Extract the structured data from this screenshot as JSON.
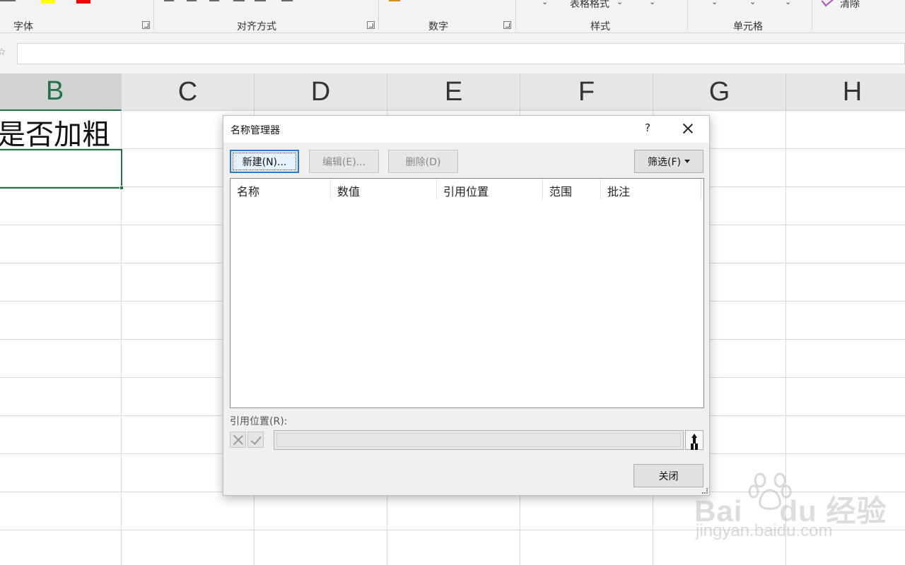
{
  "ribbon": {
    "groups": [
      {
        "label": "字体"
      },
      {
        "label": "对齐方式"
      },
      {
        "label": "数字"
      },
      {
        "label": "样式"
      },
      {
        "label": "单元格"
      }
    ],
    "table_format_label": "表格格式",
    "clear_label": "清除",
    "colors": {
      "highlight": "#ffff00",
      "font_color": "#ff0000"
    }
  },
  "formula_bar": {
    "fx_icon": "fx-icon",
    "value": ""
  },
  "sheet": {
    "columns": [
      "B",
      "C",
      "D",
      "E",
      "F",
      "G",
      "H"
    ],
    "active_column": "B",
    "cell_b1": "是否加粗",
    "accent_color": "#217346"
  },
  "dialog": {
    "title": "名称管理器",
    "help": "?",
    "buttons": {
      "new": "新建(N)...",
      "edit": "编辑(E)...",
      "delete": "删除(D)",
      "filter": "筛选(F)",
      "close": "关闭"
    },
    "list_columns": [
      "名称",
      "数值",
      "引用位置",
      "范围",
      "批注"
    ],
    "refers_to_label": "引用位置(R):",
    "refers_to_value": ""
  }
}
